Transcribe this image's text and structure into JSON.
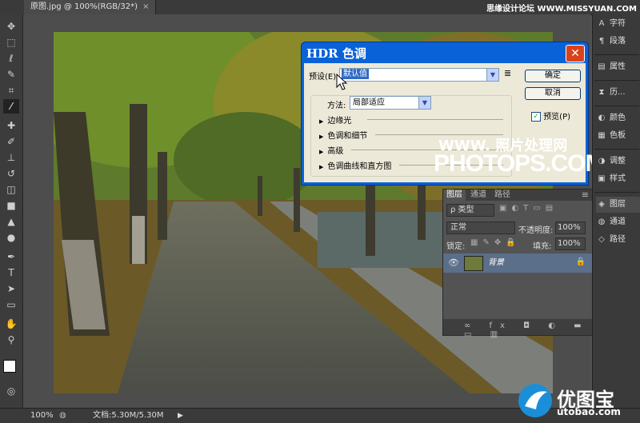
{
  "document": {
    "tab_title": "原图.jpg @ 100%(RGB/32*)",
    "tab_close": "×"
  },
  "watermark_top": "思缘设计论坛 WWW.MISSYUAN.COM",
  "toolbar_icons": [
    "move-icon",
    "marquee-icon",
    "lasso-icon",
    "quick-select-icon",
    "crop-icon",
    "eyedropper-icon",
    "healing-icon",
    "brush-icon",
    "stamp-icon",
    "history-brush-icon",
    "eraser-icon",
    "gradient-icon",
    "blur-icon",
    "dodge-icon",
    "pen-icon",
    "type-icon",
    "path-select-icon",
    "shape-icon",
    "hand-icon",
    "zoom-icon"
  ],
  "right_panels": [
    {
      "label": "字符",
      "icon": "A"
    },
    {
      "label": "段落",
      "icon": "¶"
    },
    {
      "label": "属性",
      "icon": "▤"
    },
    {
      "label": "历...",
      "icon": "⧗"
    },
    {
      "label": "颜色",
      "icon": "◐"
    },
    {
      "label": "色板",
      "icon": "▦"
    },
    {
      "label": "调整",
      "icon": "◑"
    },
    {
      "label": "样式",
      "icon": "▣"
    },
    {
      "label": "图层",
      "icon": "◈"
    },
    {
      "label": "通道",
      "icon": "◍"
    },
    {
      "label": "路径",
      "icon": "◇"
    }
  ],
  "dialog": {
    "title": "HDR 色调",
    "close": "✕",
    "preset_label": "预设(E):",
    "preset_value": "默认值",
    "ok": "确定",
    "cancel": "取消",
    "preview_label": "预览(P)",
    "preview_checked": "✓",
    "method_label": "方法:",
    "method_value": "局部适应",
    "sections": [
      "边缘光",
      "色调和细节",
      "高级",
      "色调曲线和直方图"
    ]
  },
  "watermark": {
    "line1": "WWW. 照片处理网",
    "line2": "PHOTOPS.COM"
  },
  "layers_panel": {
    "tabs": [
      "图层",
      "通道",
      "路径"
    ],
    "filter_label": "ρ 类型",
    "blend_mode": "正常",
    "opacity_label": "不透明度:",
    "opacity_value": "100%",
    "lock_label": "锁定:",
    "fill_label": "填充:",
    "fill_value": "100%",
    "layer_name": "背景",
    "footer_icons": [
      "∞",
      "fx",
      "◘",
      "◐",
      "▬",
      "▭",
      "🗑"
    ]
  },
  "status": {
    "zoom": "100%",
    "doc_info": "文档:5.30M/5.30M"
  },
  "logo": {
    "text": "优图宝",
    "url": "utobao.com"
  }
}
